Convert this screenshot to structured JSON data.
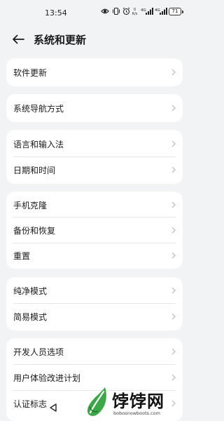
{
  "status_bar": {
    "time": "13:54",
    "net_speed_value": "0",
    "net_speed_unit": "K/s",
    "signal_label_1": "4G",
    "signal_label_2": "4G",
    "battery": "71",
    "icons": [
      "eye-icon",
      "vibrate-icon",
      "alarm-icon",
      "net-speed",
      "signal-4g-icon",
      "signal-4g-icon",
      "battery-icon"
    ]
  },
  "header": {
    "back_icon": "arrow-left-icon",
    "title": "系统和更新"
  },
  "groups": [
    {
      "items": [
        {
          "label": "软件更新"
        }
      ]
    },
    {
      "items": [
        {
          "label": "系统导航方式"
        }
      ]
    },
    {
      "items": [
        {
          "label": "语言和输入法"
        },
        {
          "label": "日期和时间"
        }
      ]
    },
    {
      "items": [
        {
          "label": "手机克隆"
        },
        {
          "label": "备份和恢复"
        },
        {
          "label": "重置"
        }
      ]
    },
    {
      "items": [
        {
          "label": "纯净模式"
        },
        {
          "label": "简易模式"
        }
      ]
    },
    {
      "items": [
        {
          "label": "开发人员选项"
        },
        {
          "label": "用户体验改进计划"
        },
        {
          "label": "认证标志"
        }
      ]
    }
  ],
  "nav_bar": {
    "back_icon": "triangle-back-icon"
  },
  "watermark": {
    "text": "饽饽网",
    "url": "bobosnowboots.com"
  },
  "colors": {
    "background": "#f1f3f5",
    "card": "#ffffff",
    "chevron": "#b5b8bd",
    "divider": "#e6e7ea",
    "logo_green": "#3aa845"
  }
}
